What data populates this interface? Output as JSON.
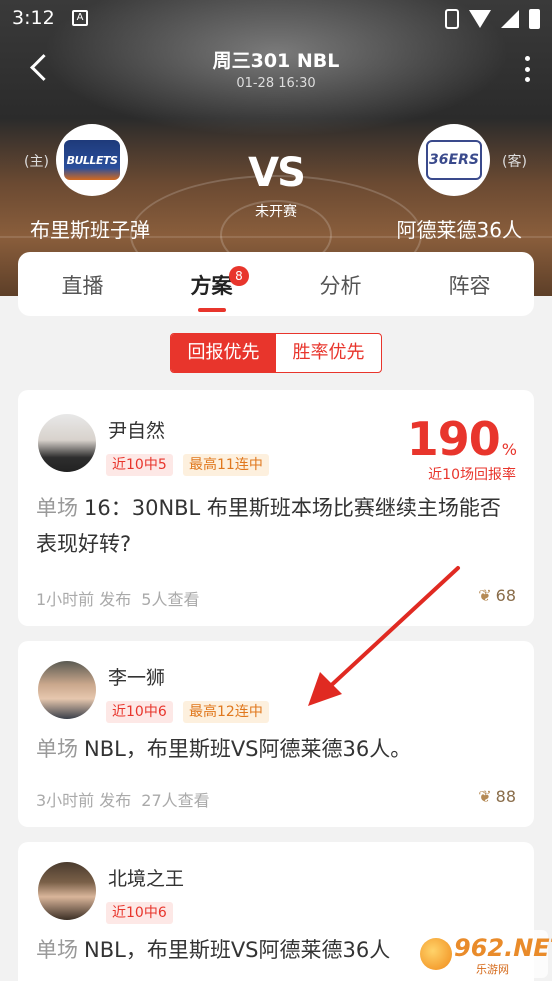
{
  "status_bar": {
    "time": "3:12",
    "notif_glyph": "A"
  },
  "header": {
    "title": "周三301 NBL",
    "datetime": "01-28 16:30",
    "home_tag": "(主)",
    "away_tag": "(客)",
    "vs": "VS",
    "state": "未开赛",
    "home_team": "布里斯班子弹",
    "away_team": "阿德莱德36人",
    "home_logo_text": "BULLETS",
    "away_logo_text": "36ERS"
  },
  "tabs": [
    {
      "label": "直播"
    },
    {
      "label": "方案",
      "badge": "8",
      "active": true
    },
    {
      "label": "分析"
    },
    {
      "label": "阵容"
    }
  ],
  "sort": {
    "option1": "回报优先",
    "option2": "胜率优先",
    "selected": "回报优先"
  },
  "cards": [
    {
      "author": "尹自然",
      "tags": [
        "近10中5",
        "最高11连中"
      ],
      "rate": "190",
      "rate_unit": "%",
      "rate_label": "近10场回报率",
      "title_prefix": "单场",
      "title": "16：30NBL 布里斯班本场比赛继续主场能否表现好转?",
      "time": "1小时前 发布",
      "views": "5人查看",
      "likes": "68"
    },
    {
      "author": "李一狮",
      "tags": [
        "近10中6",
        "最高12连中"
      ],
      "title_prefix": "单场",
      "title": "NBL，布里斯班VS阿德莱德36人。",
      "time": "3小时前 发布",
      "views": "27人查看",
      "likes": "88"
    },
    {
      "author": "北境之王",
      "tags": [
        "近10中6"
      ],
      "title_prefix": "单场",
      "title": "NBL，布里斯班VS阿德莱德36人"
    }
  ],
  "watermark": {
    "text": "962.NET",
    "sub": "乐游网"
  },
  "colors": {
    "accent": "#e8352c",
    "tag_orange": "#e0781e",
    "likes": "#8a6d4a"
  }
}
